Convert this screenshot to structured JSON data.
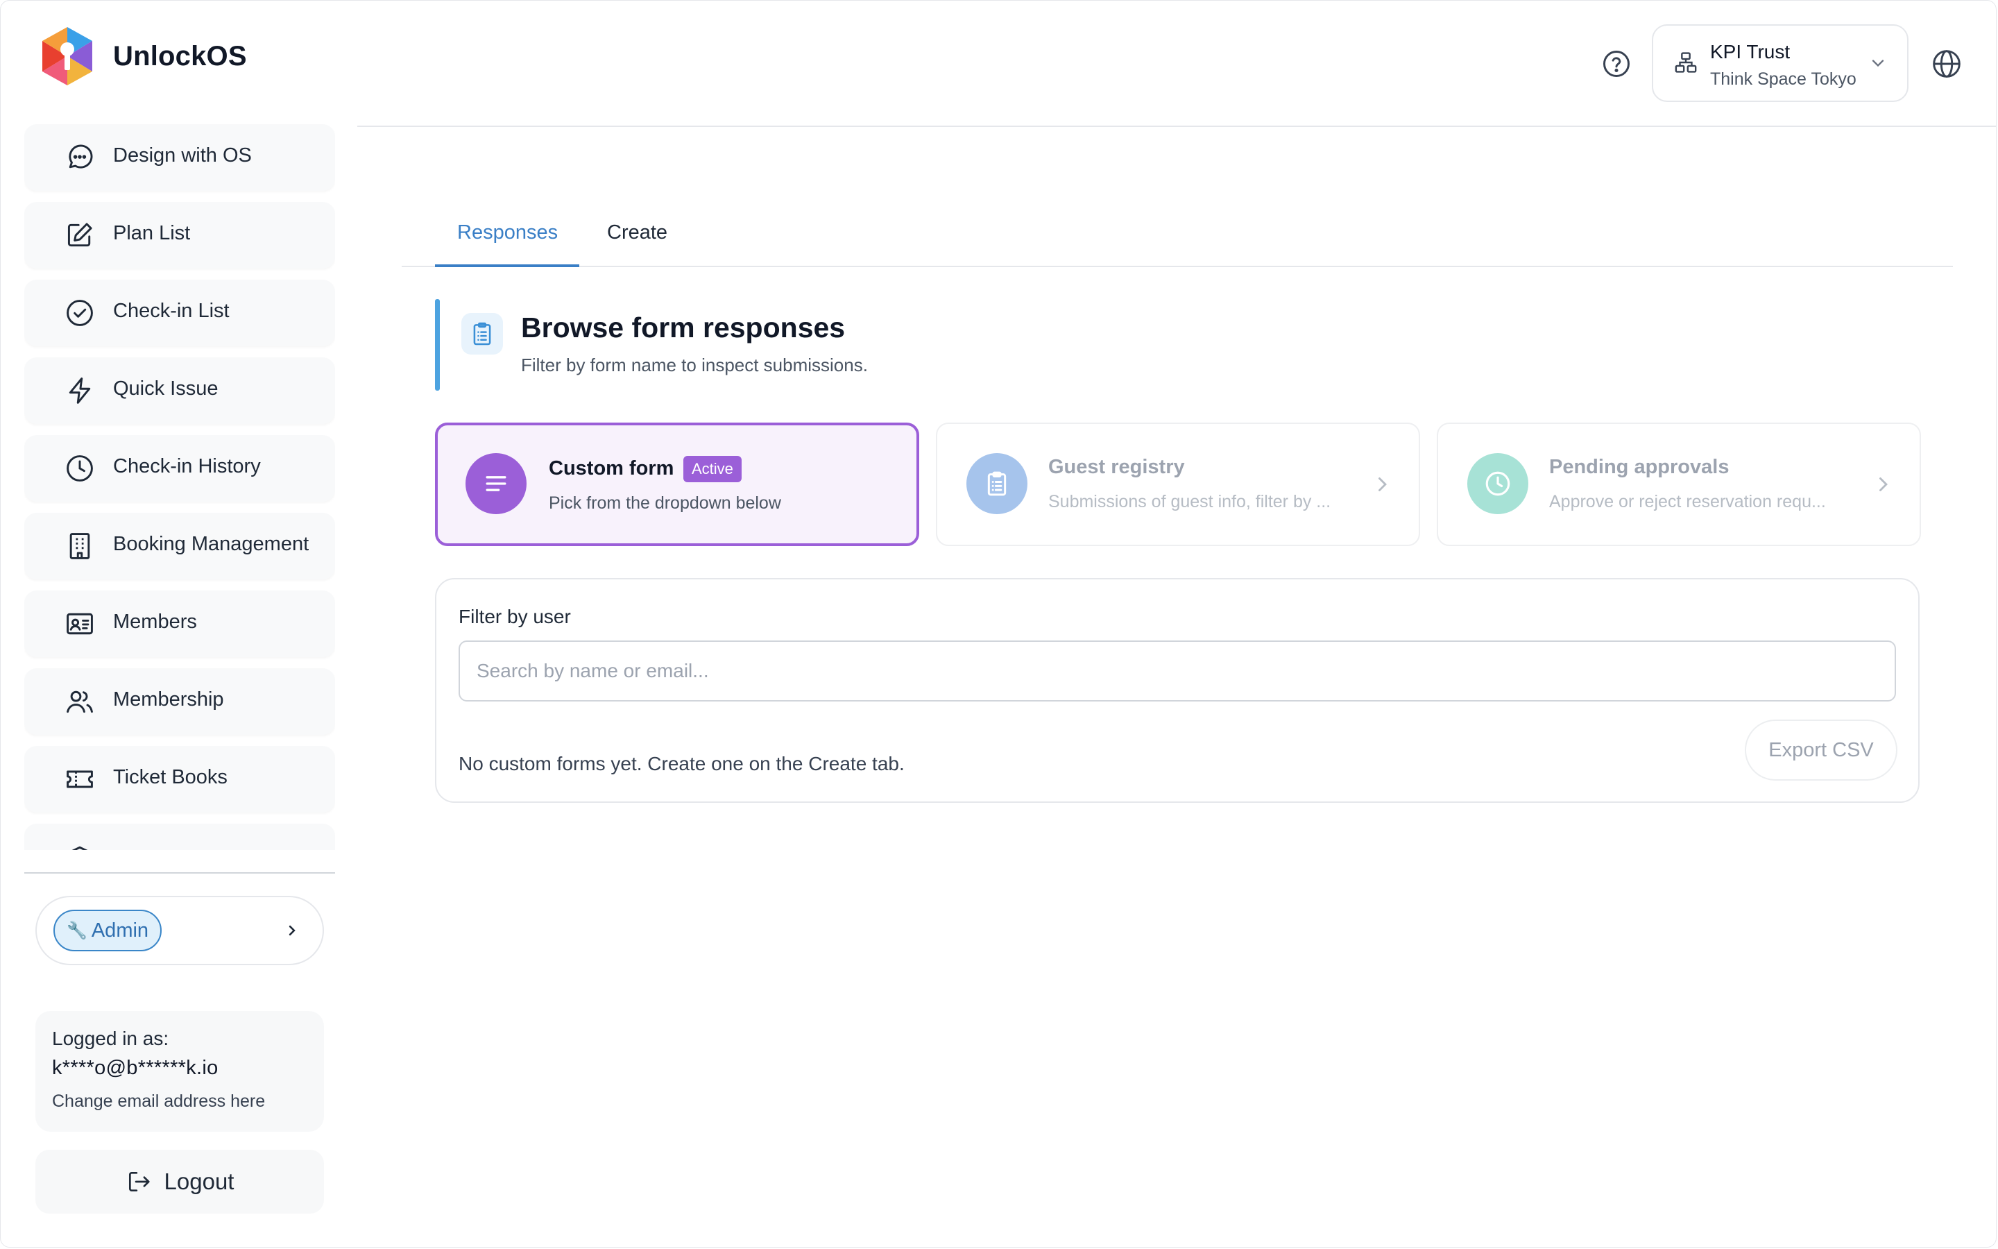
{
  "app": {
    "name": "UnlockOS"
  },
  "header": {
    "org_name": "KPI Trust",
    "org_location": "Think Space Tokyo"
  },
  "sidebar": {
    "items": [
      {
        "label": "Design with OS",
        "icon": "chat-bubble-icon"
      },
      {
        "label": "Plan List",
        "icon": "edit-icon"
      },
      {
        "label": "Check-in List",
        "icon": "check-circle-icon"
      },
      {
        "label": "Quick Issue",
        "icon": "lightning-icon"
      },
      {
        "label": "Check-in History",
        "icon": "clock-icon"
      },
      {
        "label": "Booking Management",
        "icon": "building-icon"
      },
      {
        "label": "Members",
        "icon": "id-card-icon"
      },
      {
        "label": "Membership",
        "icon": "users-icon"
      },
      {
        "label": "Ticket Books",
        "icon": "ticket-icon"
      }
    ],
    "role_badge": "Admin",
    "login": {
      "label": "Logged in as:",
      "email": "k****o@b******k.io",
      "change_link": "Change email address here"
    },
    "logout_label": "Logout"
  },
  "tabs": [
    {
      "label": "Responses",
      "active": true
    },
    {
      "label": "Create",
      "active": false
    }
  ],
  "section": {
    "title": "Browse form responses",
    "subtitle": "Filter by form name to inspect submissions."
  },
  "form_cards": [
    {
      "title": "Custom form",
      "subtitle": "Pick from the dropdown below",
      "badge": "Active",
      "icon": "list-lines-icon",
      "color": "#9b5fd8",
      "state": "active"
    },
    {
      "title": "Guest registry",
      "subtitle": "Submissions of guest info, filter by ...",
      "icon": "clipboard-icon",
      "color": "#a6c4ec",
      "state": "inactive"
    },
    {
      "title": "Pending approvals",
      "subtitle": "Approve or reject reservation requ...",
      "icon": "clock-icon",
      "color": "#a7e2d6",
      "state": "inactive"
    }
  ],
  "filter": {
    "label": "Filter by user",
    "placeholder": "Search by name or email...",
    "value": "",
    "empty_message": "No custom forms yet. Create one on the Create tab.",
    "export_label": "Export CSV"
  },
  "colors": {
    "accent_blue": "#3a7fc6",
    "accent_purple": "#9b5fd8",
    "section_bar": "#4da3e0"
  }
}
